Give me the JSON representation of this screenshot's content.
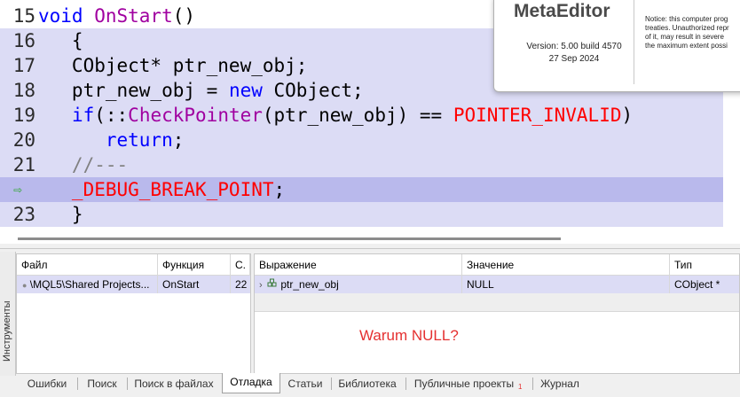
{
  "editor": {
    "lines": [
      {
        "num": "15",
        "segments": [
          {
            "t": "void ",
            "c": "kw"
          },
          {
            "t": "OnStart",
            "c": "fn"
          },
          {
            "t": "()",
            "c": "txt"
          }
        ]
      },
      {
        "num": "16",
        "segments": [
          {
            "t": "   {",
            "c": "txt"
          }
        ]
      },
      {
        "num": "17",
        "segments": [
          {
            "t": "   CObject* ptr_new_obj;",
            "c": "txt"
          }
        ]
      },
      {
        "num": "18",
        "segments": [
          {
            "t": "   ptr_new_obj = ",
            "c": "txt"
          },
          {
            "t": "new",
            "c": "kw"
          },
          {
            "t": " CObject;",
            "c": "txt"
          }
        ]
      },
      {
        "num": "19",
        "segments": [
          {
            "t": "   ",
            "c": "txt"
          },
          {
            "t": "if",
            "c": "kw"
          },
          {
            "t": "(::",
            "c": "txt"
          },
          {
            "t": "CheckPointer",
            "c": "fn"
          },
          {
            "t": "(ptr_new_obj) == ",
            "c": "txt"
          },
          {
            "t": "POINTER_INVALID",
            "c": "red"
          },
          {
            "t": ")",
            "c": "txt"
          }
        ]
      },
      {
        "num": "20",
        "segments": [
          {
            "t": "      ",
            "c": "txt"
          },
          {
            "t": "return",
            "c": "kw"
          },
          {
            "t": ";",
            "c": "txt"
          }
        ]
      },
      {
        "num": "21",
        "segments": [
          {
            "t": "   //---",
            "c": "cmt"
          }
        ]
      },
      {
        "num": "⇨",
        "segments": [
          {
            "t": "   _DEBUG_BREAK_POINT",
            "c": "red"
          },
          {
            "t": ";",
            "c": "txt"
          }
        ]
      },
      {
        "num": "23",
        "segments": [
          {
            "t": "   }",
            "c": "txt"
          }
        ]
      }
    ]
  },
  "about": {
    "title": "MetaEditor",
    "version": "Version: 5.00 build 4570",
    "date": "27 Sep 2024",
    "notice": [
      "Notice: this computer prog",
      "treaties. Unauthorized repr",
      "of it, may result in severe",
      "the maximum extent possi"
    ]
  },
  "side_panel_label": "Инструменты",
  "callstack": {
    "headers": [
      "Файл",
      "Функция",
      "С."
    ],
    "rows": [
      {
        "file": "\\MQL5\\Shared Projects...",
        "function": "OnStart",
        "line": "22"
      }
    ]
  },
  "watch": {
    "headers": [
      "Выражение",
      "Значение",
      "Тип"
    ],
    "rows": [
      {
        "expression": "ptr_new_obj",
        "value": "NULL",
        "type": "CObject *"
      }
    ]
  },
  "annotation": "Warum NULL?",
  "tabs": [
    "Ошибки",
    "Поиск",
    "Поиск в файлах",
    "Отладка",
    "Статьи",
    "Библиотека",
    "Публичные проекты",
    "Журнал"
  ],
  "tab_badge": "1",
  "active_tab": "Отладка",
  "colors": {
    "keyword": "#0000ff",
    "function": "#a000a0",
    "constant": "#ff0000",
    "comment": "#808080",
    "highlight": "#dcdcf5",
    "current_line": "#b9b9ec",
    "annotation": "#e53030"
  }
}
